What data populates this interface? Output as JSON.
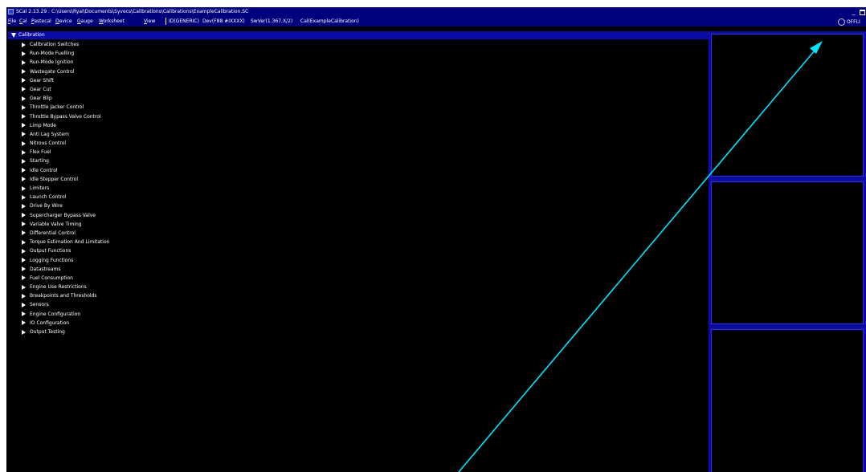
{
  "window": {
    "title": "SCal 2.13.29  :  C:\\Users\\Ryal\\Documents\\Syvecs\\Calibrations\\Calibrations\\ExampleCalibration.SC",
    "minimize_label": "_",
    "maximize_label": ""
  },
  "menubar": {
    "items": [
      {
        "underline": "F",
        "rest": "ile"
      },
      {
        "underline": "C",
        "rest": "al"
      },
      {
        "underline": "P",
        "rest": "astecal"
      },
      {
        "underline": "D",
        "rest": "evice"
      },
      {
        "underline": "G",
        "rest": "auge"
      },
      {
        "underline": "W",
        "rest": "orksheet"
      },
      {
        "underline": "V",
        "rest": "iew"
      }
    ],
    "info": {
      "id": "ID(GENERIC)",
      "dev": "Dev(F88 #IXXXX)",
      "swver": "SwVer(1.367.X/2)",
      "cal": "Cal(ExampleCalibration)"
    }
  },
  "status": {
    "label": "OFFLI"
  },
  "tree": {
    "root_label": "Calibration",
    "items": [
      "Calibration Switches",
      "Run-Mode Fuelling",
      "Run-Mode Ignition",
      "Wastegate Control",
      "Gear Shift",
      "Gear Cut",
      "Gear Blip",
      "Throttle Jacker Control",
      "Throttle Bypass Valve Control",
      "Limp Mode",
      "Anti Lag System",
      "Nitrous Control",
      "Flex Fuel",
      "Starting",
      "Idle Control",
      "Idle Stepper Control",
      "Limiters",
      "Launch Control",
      "Drive By Wire",
      "Supercharger Bypass Valve",
      "Variable Valve Timing",
      "Differential Control",
      "Torque Estimation And Limitation",
      "Output Functions",
      "Logging Functions",
      "Datastreams",
      "Fuel Consumption",
      "Engine Use Restrictions",
      "Breakpoints and Thresholds",
      "Sensors",
      "Engine Configuration",
      "IO Configuration",
      "Output Testing"
    ]
  },
  "annotation": {
    "color": "#00e5ff"
  }
}
